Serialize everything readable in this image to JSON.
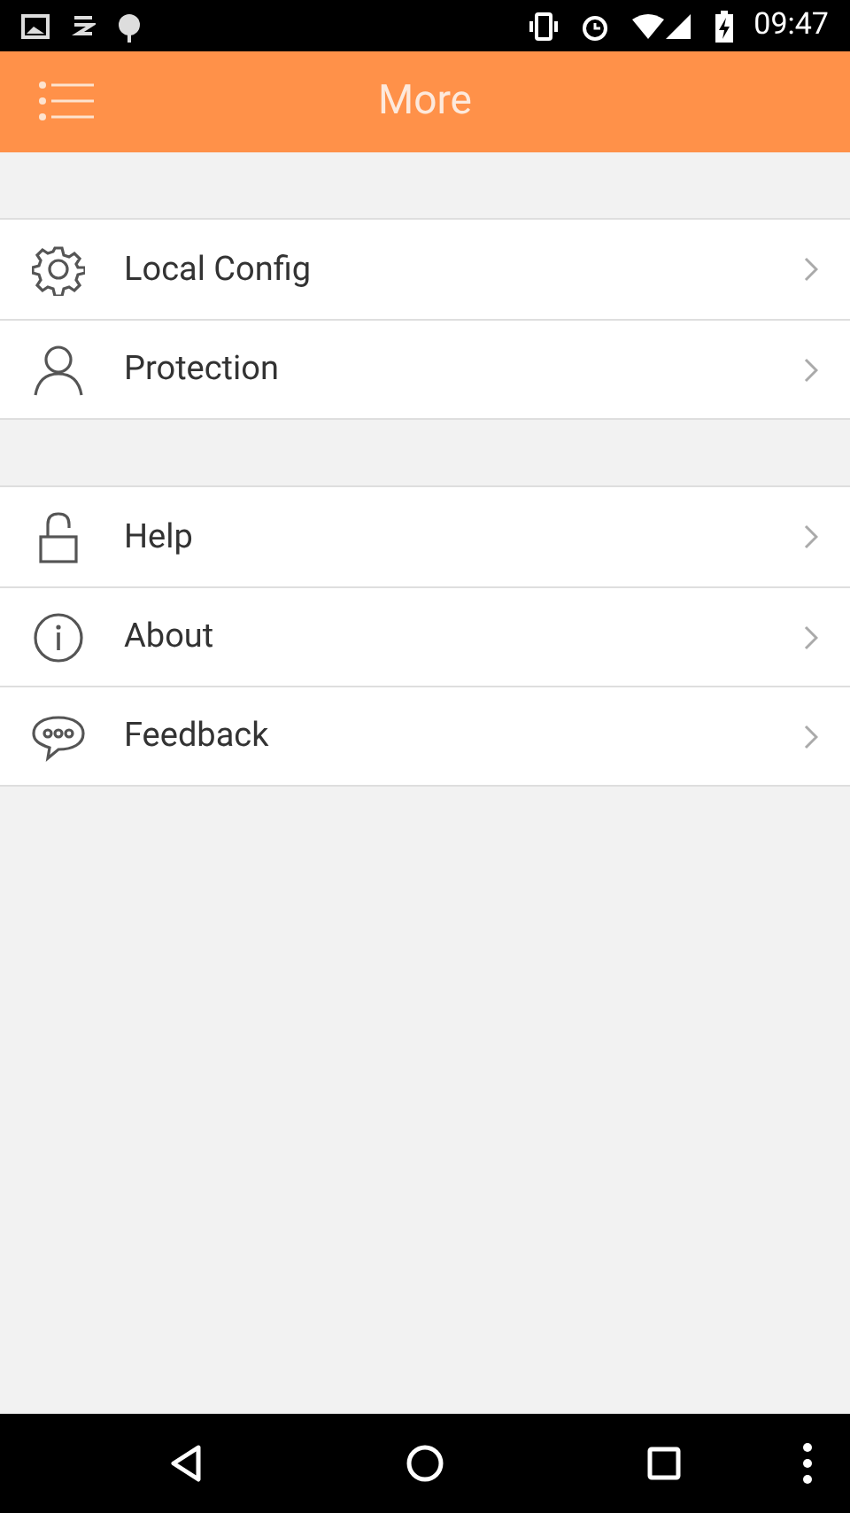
{
  "status_bar": {
    "time": "09:47"
  },
  "header": {
    "title": "More"
  },
  "groups": [
    {
      "items": [
        {
          "label": "Local Config",
          "kind": "gear"
        },
        {
          "label": "Protection",
          "kind": "person"
        }
      ]
    },
    {
      "items": [
        {
          "label": "Help",
          "kind": "lock"
        },
        {
          "label": "About",
          "kind": "info"
        },
        {
          "label": "Feedback",
          "kind": "chat"
        }
      ]
    }
  ]
}
